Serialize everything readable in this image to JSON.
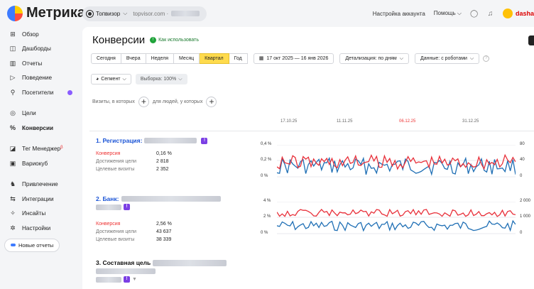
{
  "app": {
    "logo_text": "Метрика"
  },
  "topbar": {
    "counter_name": "Топвизор",
    "counter_url": "topvisor.com ·",
    "links": [
      "Настройка аккаунта",
      "Помощь"
    ],
    "user": "dasha"
  },
  "sidebar": {
    "items": [
      {
        "label": "Обзор",
        "icon": "grid-icon"
      },
      {
        "label": "Дашборды",
        "icon": "dashboard-icon"
      },
      {
        "label": "Отчеты",
        "icon": "reports-icon"
      },
      {
        "label": "Поведение",
        "icon": "play-icon"
      },
      {
        "label": "Посетители",
        "icon": "person-icon"
      },
      {
        "label": "Цели",
        "icon": "target-icon"
      },
      {
        "label": "Конверсии",
        "icon": "percent-icon"
      },
      {
        "label": "Тег Менеджер",
        "icon": "tag-icon",
        "sup": "β"
      },
      {
        "label": "Вариокуб",
        "icon": "cube-icon"
      },
      {
        "label": "Привлечение",
        "icon": "acquisition-icon"
      },
      {
        "label": "Интеграции",
        "icon": "integration-icon"
      },
      {
        "label": "Инсайты",
        "icon": "insights-icon"
      },
      {
        "label": "Настройки",
        "icon": "gear-icon"
      }
    ],
    "active": "Конверсии",
    "new_reports": "Новые отчеты"
  },
  "page": {
    "title": "Конверсии",
    "howto": "Как использовать",
    "periods": [
      "Сегодня",
      "Вчера",
      "Неделя",
      "Месяц",
      "Квартал",
      "Год"
    ],
    "selected_period": "Квартал",
    "date_range": "17 окт 2025 — 16 янв 2026",
    "detail": "Детализация: по дням",
    "data": "Данные: с роботами",
    "segment": "Сегмент",
    "sample": "Выборка: 100%",
    "visits_prefix": "Визиты, в которых",
    "visits_middle": "для людей, у которых"
  },
  "axis": {
    "dates": [
      "17.10.25",
      "11.11.25",
      "06.12.25",
      "31.12.25"
    ],
    "highlight_date": "06.12.25"
  },
  "goals": [
    {
      "title": "1. Регистрация:",
      "metrics": [
        {
          "k": "Конверсия",
          "v": "0,16 %",
          "red": true
        },
        {
          "k": "Достижения цели",
          "v": "2 818",
          "red": false
        },
        {
          "k": "Целевые визиты",
          "v": "2 352",
          "red": false
        }
      ],
      "left_ticks": [
        "0,4 %",
        "0,2 %",
        "0 %"
      ],
      "right_ticks": [
        "80",
        "40",
        "0"
      ]
    },
    {
      "title": "2. Банк:",
      "metrics": [
        {
          "k": "Конверсия",
          "v": "2,56 %",
          "red": true
        },
        {
          "k": "Достижения цели",
          "v": "43 637",
          "red": false
        },
        {
          "k": "Целевые визиты",
          "v": "38 339",
          "red": false
        }
      ],
      "left_ticks": [
        "4 %",
        "2 %",
        "0 %"
      ],
      "right_ticks": [
        "2 000",
        "1 000",
        "0"
      ]
    },
    {
      "title": "3. Составная цель",
      "metrics": [],
      "left_ticks": [],
      "right_ticks": []
    }
  ],
  "colors": {
    "conversion": "#e8303a",
    "visits": "#1f6fb5",
    "selected": "#ffdb4d"
  }
}
